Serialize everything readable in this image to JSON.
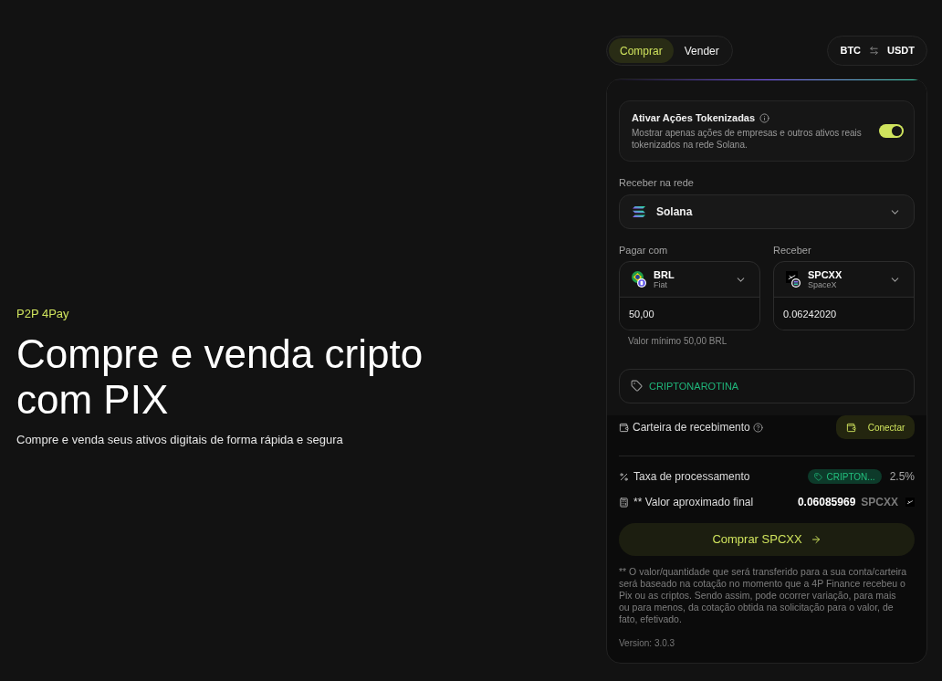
{
  "hero": {
    "eyebrow": "P2P 4Pay",
    "title": "Compre e venda cripto com PIX",
    "subtitle": "Compre e venda seus ativos digitais de forma rápida e segura"
  },
  "mode_tabs": [
    {
      "label": "Comprar",
      "selected": true
    },
    {
      "label": "Vender",
      "selected": false
    }
  ],
  "pair": {
    "base": "BTC",
    "quote": "USDT"
  },
  "tokenized_toggle": {
    "title": "Ativar Ações Tokenizadas",
    "description": "Mostrar apenas ações de empresas e outros ativos reais tokenizados na rede Solana.",
    "on": true
  },
  "network": {
    "label": "Receber na rede",
    "value": "Solana"
  },
  "pay": {
    "label": "Pagar com",
    "asset": "BRL",
    "sub": "Fiat",
    "amount": "50,00",
    "hint": "Valor mínimo 50,00 BRL"
  },
  "receive": {
    "label": "Receber",
    "asset": "SPCXX",
    "sub": "SpaceX",
    "amount": "0.06242020"
  },
  "coupon": {
    "value": "CRIPTONAROTINA"
  },
  "wallet": {
    "label": "Carteira de recebimento",
    "button": "Conectar"
  },
  "summary": [
    {
      "kind": "fee",
      "label": "Taxa de processamento",
      "badge": "CRIPTON...",
      "value": "2.5%"
    },
    {
      "kind": "total",
      "label": "** Valor aproximado final",
      "value": "0.06085969",
      "unit": "SPCXX"
    }
  ],
  "submit": "Comprar SPCXX",
  "footnote": "** O valor/quantidade que será transferido para a sua conta/carteira será baseado na cotação no momento que a 4P Finance recebeu o Pix ou as criptos. Sendo assim, pode ocorrer variação, para mais ou para menos, da cotação obtida na solicitação para o valor, de fato, efetivado.",
  "version": "Version: 3.0.3"
}
